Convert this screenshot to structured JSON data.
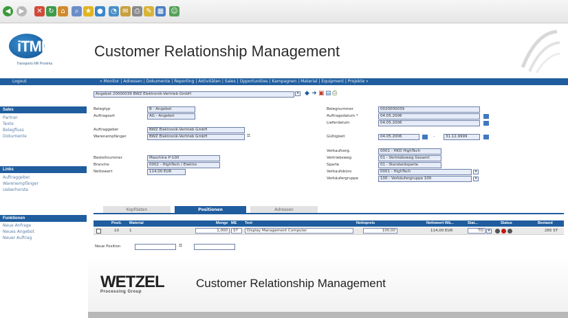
{
  "header": {
    "logo_text": "iTML",
    "logo_sub": "Transports NR Proxima",
    "app_title": "Customer Relationship Management"
  },
  "navbar": {
    "logout": "Logout",
    "menu": "« Monitor | Adressen | Dokumente | Reporting | Aktivitäten | Sales | Opportunities | Kampagnen | Material | Equipment | Projekte »"
  },
  "sidebar": {
    "sales": {
      "title": "Sales",
      "items": [
        "Partner",
        "Texte",
        "Belegfluss",
        "Dokumente"
      ]
    },
    "links": {
      "title": "Links",
      "items": [
        "Auftraggeber",
        "Warenempfänger",
        "Ueberhorste"
      ]
    },
    "funktionen": {
      "title": "Funktionen",
      "items": [
        "Neue Anfrage",
        "Neues Angebot",
        "Neuer Auftrag"
      ]
    }
  },
  "document_select": {
    "value": "Angebot 20000039 BWZ Elektronik-Vertrieb GmbH"
  },
  "form_left": {
    "belegtyp_label": "Belegtyp",
    "belegtyp_value": "B - Angebot",
    "auftragsart_label": "Auftragsart",
    "auftragsart_value": "AG - Angebot",
    "auftraggeber_label": "Auftraggeber",
    "auftraggeber_value": "BWZ Elektronik-Vertrieb GmbH",
    "warenempfaenger_label": "Warenempfänger",
    "warenempfaenger_value": "BWZ Elektronik-Vertrieb GmbH",
    "bestellnummer_label": "Bestellnummer",
    "bestellnummer_value": "Maschine P-100",
    "branche_label": "Branche",
    "branche_value": "0002 - HighTech / Elektro",
    "nettowert_label": "Nettowert",
    "nettowert_value": "114,00 EUR"
  },
  "form_right": {
    "belegnummer_label": "Belegnummer",
    "belegnummer_value": "0020000039",
    "auftragsdatum_label": "Auftragsdatum *",
    "auftragsdatum_value": "04.05.2006",
    "lieferdatum_label": "Lieferdatum",
    "lieferdatum_value": "04.05.2006",
    "gueltigkeit_label": "Gültigkeit",
    "gueltigkeit_from": "04.05.2006",
    "gueltigkeit_sep": "-",
    "gueltigkeit_to": "31.12.9999",
    "verkaufsorg_label": "Verkaufsorg.",
    "verkaufsorg_value": "0001 - HKD HighTech",
    "vertriebsweg_label": "Vertriebsweg",
    "vertriebsweg_value": "01 - Vertriebsweg Gesamt",
    "sparte_label": "Sparte",
    "sparte_value": "01 - Standardsparte",
    "verkaufsbuero_label": "Verkaufsbüro",
    "verkaufsbuero_value": "0001 - HighTech",
    "verkaeufergruppe_label": "Verkäufergruppe",
    "verkaeufergruppe_value": "100 - Verkäufergruppe 100"
  },
  "tabs": [
    {
      "label": "Kopfdaten"
    },
    {
      "label": "Positionen"
    },
    {
      "label": "Adressen"
    }
  ],
  "table": {
    "headers": [
      "Posit.",
      "Material",
      "Menge",
      "ME",
      "Text",
      "Nettopreis",
      "Nettowert Wä...",
      "Stat...",
      "Status",
      "Bestand"
    ],
    "rows": [
      {
        "pos": "10",
        "material": "1",
        "menge": "1,000",
        "me": "ST",
        "text": "Display Management Computer",
        "nettopreis": "100,00",
        "nettowert": "114,00 EUR",
        "stat": "TO",
        "bestand": "265 ST"
      }
    ],
    "new_position_label": "Neue Position"
  },
  "footer": {
    "company": "WETZEL",
    "company_sub": "Processing Group",
    "title": "Customer Relationship Management"
  },
  "colors": {
    "primary_blue": "#1f5d9e",
    "input_bg": "#e6ecf8",
    "status_red": "#c01818",
    "status_grey": "#555555"
  }
}
